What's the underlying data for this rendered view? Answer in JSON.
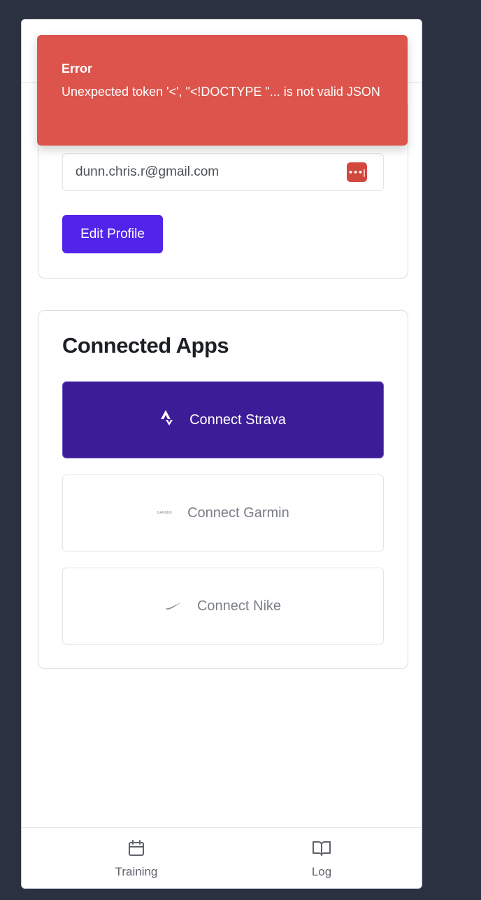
{
  "toast": {
    "title": "Error",
    "message": "Unexpected token '<', \"<!DOCTYPE \"... is not valid JSON",
    "color": "#dc544b"
  },
  "profile": {
    "email_value": "dunn.chris.r@gmail.com",
    "password_manager_icon": "more-dots-icon",
    "edit_button_label": "Edit Profile",
    "accent_color": "#5224ea"
  },
  "connected_apps": {
    "title": "Connected Apps",
    "apps": [
      {
        "label": "Connect Strava",
        "icon": "strava-icon",
        "color": "#3c1d97"
      },
      {
        "label": "Connect Garmin",
        "icon": "garmin-logo",
        "logo_text": "GARMIN"
      },
      {
        "label": "Connect Nike",
        "icon": "nike-swoosh-icon"
      }
    ]
  },
  "bottom_nav": {
    "items": [
      {
        "label": "Training",
        "icon": "calendar-icon"
      },
      {
        "label": "Log",
        "icon": "book-open-icon"
      }
    ]
  }
}
